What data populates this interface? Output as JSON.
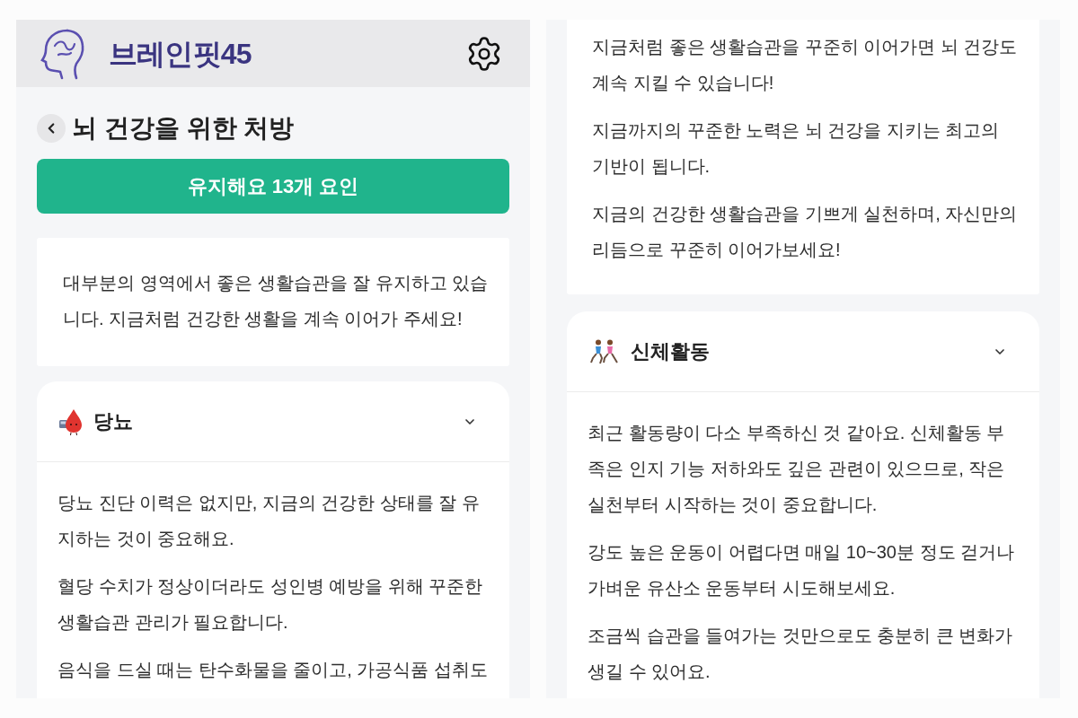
{
  "screens": [
    {
      "header": {
        "logo_text": "브레인핏45"
      },
      "page_title": "뇌 건강을 위한 처방",
      "summary_button": "유지해요 13개 요인",
      "summary_card": {
        "paragraphs": [
          "대부분의 영역에서 좋은 생활습관을 잘 유지하고 있습니다. 지금처럼 건강한 생활을 계속 이어가 주세요!"
        ]
      },
      "sections": [
        {
          "kind": "diabetes",
          "title": "당뇨",
          "expanded": true,
          "paragraphs": [
            "당뇨 진단 이력은 없지만, 지금의 건강한 상태를 잘 유지하는 것이 중요해요.",
            "혈당 수치가 정상이더라도 성인병 예방을 위해 꾸준한 생활습관 관리가 필요합니다.",
            "음식을 드실 때는 탄수화물을 줄이고, 가공식품 섭취도"
          ]
        }
      ]
    },
    {
      "summary_card": {
        "paragraphs": [
          "지금처럼 좋은 생활습관을 꾸준히 이어가면 뇌 건강도 계속 지킬 수 있습니다!",
          "지금까지의 꾸준한 노력은 뇌 건강을 지키는 최고의 기반이 됩니다.",
          "지금의 건강한 생활습관을 기쁘게 실천하며, 자신만의 리듬으로 꾸준히 이어가보세요!"
        ]
      },
      "sections": [
        {
          "kind": "physical_activity",
          "title": "신체활동",
          "expanded": true,
          "paragraphs": [
            "최근 활동량이 다소 부족하신 것 같아요. 신체활동 부족은 인지 기능 저하와도 깊은 관련이 있으므로, 작은 실천부터 시작하는 것이 중요합니다.",
            "강도 높은 운동이 어렵다면 매일 10~30분 정도 걷거나 가벼운 유산소 운동부터 시도해보세요.",
            "조금씩 습관을 들여가는 것만으로도 충분히 큰 변화가 생길 수 있어요."
          ]
        }
      ]
    }
  ]
}
